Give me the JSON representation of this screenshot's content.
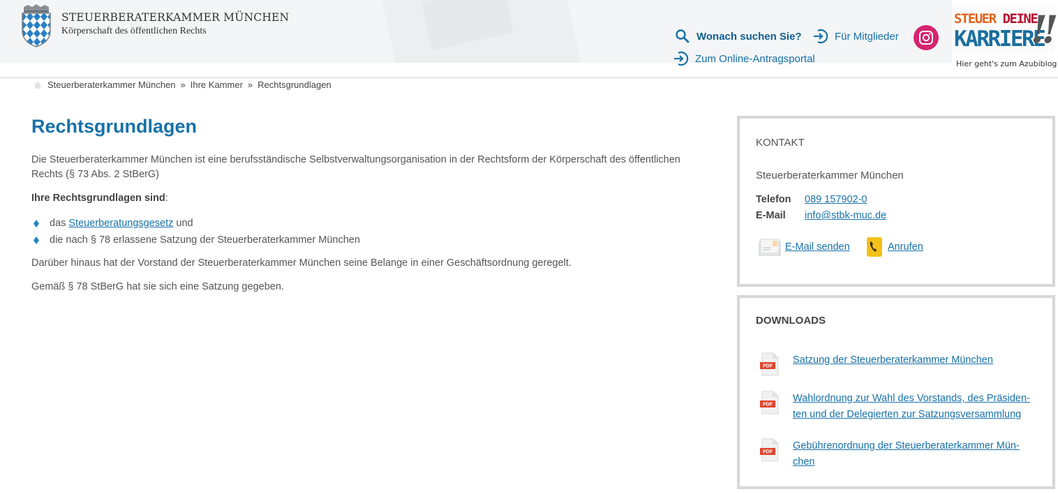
{
  "header": {
    "org_title": "STEUERBERATERKAMMER MÜNCHEN",
    "org_subtitle": "Körperschaft des öffentlichen Rechts",
    "search_label": "Wonach suchen Sie?",
    "members_label": "Für Mitglieder",
    "portal_label": "Zum Online-Antragsportal",
    "karriere_line1a": "STEUER",
    "karriere_line1b": "DEINE",
    "karriere_line2": "KARRIERE",
    "karriere_mark": "!!",
    "azubi_label": "Hier geht's zum Azubiblog"
  },
  "breadcrumb": {
    "items": [
      "Steuerberaterkammer München",
      "Ihre Kammer",
      "Rechtsgrundlagen"
    ],
    "separator": "»"
  },
  "main": {
    "title": "Rechtsgrundlagen",
    "intro": "Die Steuerberaterkammer München ist eine berufsständische Selbstverwaltungsorganisation in der Rechtsform der Körperschaft des öffentlichen Rechts (§ 73 Abs. 2 StBerG)",
    "list_heading": "Ihre Rechtsgrundlagen sind",
    "list_heading_colon": ":",
    "item1_pre": "das ",
    "item1_link": "Steuerberatungsgesetz",
    "item1_post": " und",
    "item2": "die nach § 78 erlassene Satzung der Steuerberaterkammer München",
    "para2": "Darüber hinaus hat der Vorstand der Steuerberaterkammer München seine Belange in einer Geschäftsordnung geregelt.",
    "para3": "Gemäß § 78 StBerG hat sie sich eine Satzung gegeben."
  },
  "contact": {
    "heading": "KONTAKT",
    "org": "Steuerberaterkammer München",
    "phone_label": "Telefon",
    "phone": "089 157902-0",
    "email_label": "E-Mail",
    "email": "info@stbk-muc.de",
    "send_email": "E-Mail senden",
    "call": "Anrufen"
  },
  "downloads": {
    "heading": "DOWNLOADS",
    "items": [
      {
        "lines": [
          "Satzung der Steuerberaterkammer München"
        ]
      },
      {
        "lines": [
          "Wahlordnung zur Wahl des Vorstands, des Präsiden-",
          "ten und der Delegierten zur Satzungsversammlung"
        ]
      },
      {
        "lines": [
          "Gebührenordnung der Steuerberaterkammer Mün-",
          "chen"
        ]
      }
    ],
    "pdf_badge": "PDF"
  },
  "colors": {
    "accent": "#1771a8",
    "instagram": "#d6246e",
    "pdf_red": "#e0442c"
  }
}
